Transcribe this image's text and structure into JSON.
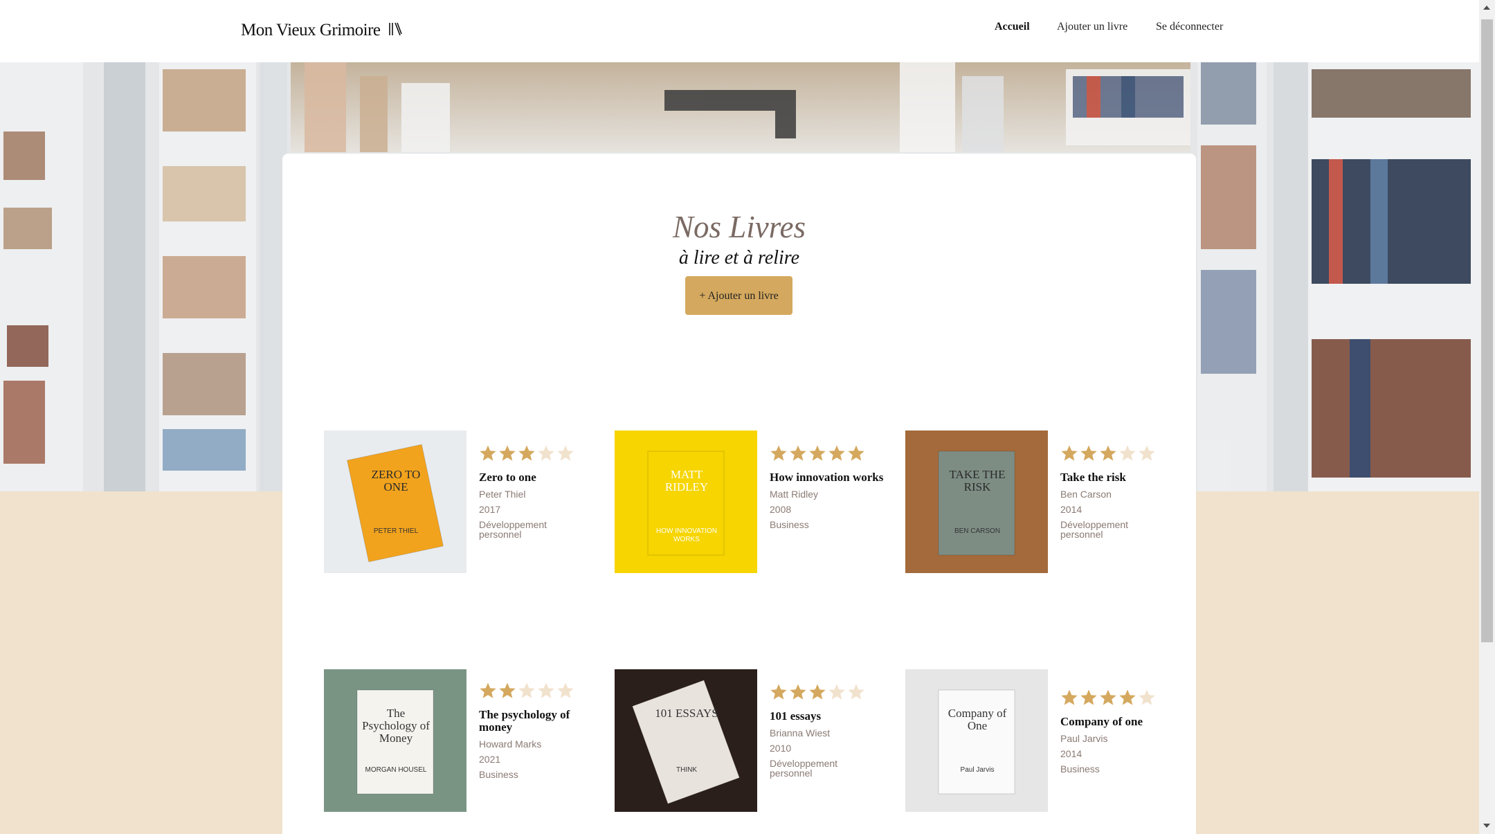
{
  "header": {
    "logo": "Mon Vieux Grimoire",
    "nav": [
      "Accueil",
      "Ajouter un livre",
      "Se déconnecter"
    ]
  },
  "main": {
    "title": "Nos Livres",
    "subtitle": "à lire et à relire",
    "add_button": "+ Ajouter un livre"
  },
  "books": [
    {
      "title": "Zero to one",
      "author": "Peter Thiel",
      "year": "2017",
      "genre": "Développement personnel",
      "rating": 3,
      "cover": {
        "bg": "#e8ecef",
        "book": "#f2a31d",
        "text": "ZERO TO ONE",
        "text2": "PETER THIEL"
      }
    },
    {
      "title": "How innovation works",
      "author": "Matt Ridley",
      "year": "2008",
      "genre": "Business",
      "rating": 5,
      "cover": {
        "bg": "#f6d500",
        "book": "#f6d500",
        "text": "MATT RIDLEY",
        "text2": "HOW INNOVATION WORKS"
      }
    },
    {
      "title": "Take the risk",
      "author": "Ben Carson",
      "year": "2014",
      "genre": "Développement personnel",
      "rating": 3,
      "cover": {
        "bg": "#a46a3b",
        "book": "#7d8d84",
        "text": "TAKE THE RISK",
        "text2": "BEN CARSON"
      }
    },
    {
      "title": "The psychology of money",
      "author": "Howard Marks",
      "year": "2021",
      "genre": "Business",
      "rating": 2,
      "cover": {
        "bg": "#7a9484",
        "book": "#f4f3ee",
        "text": "The Psychology of Money",
        "text2": "MORGAN HOUSEL"
      }
    },
    {
      "title": "101 essays",
      "author": "Brianna Wiest",
      "year": "2010",
      "genre": "Développement personnel",
      "rating": 3,
      "cover": {
        "bg": "#2b1f1c",
        "book": "#e9e3de",
        "text": "101 ESSAYS",
        "text2": "THINK"
      }
    },
    {
      "title": "Company of one",
      "author": "Paul Jarvis",
      "year": "2014",
      "genre": "Business",
      "rating": 4,
      "cover": {
        "bg": "#e6e6e6",
        "book": "#fafafa",
        "text": "Company of One",
        "text2": "Paul Jarvis"
      }
    }
  ],
  "colors": {
    "accent": "#d4a85e",
    "star_on": "#d4a85e",
    "star_off": "#f1e2cd",
    "page_bg": "#f1e2cd"
  }
}
